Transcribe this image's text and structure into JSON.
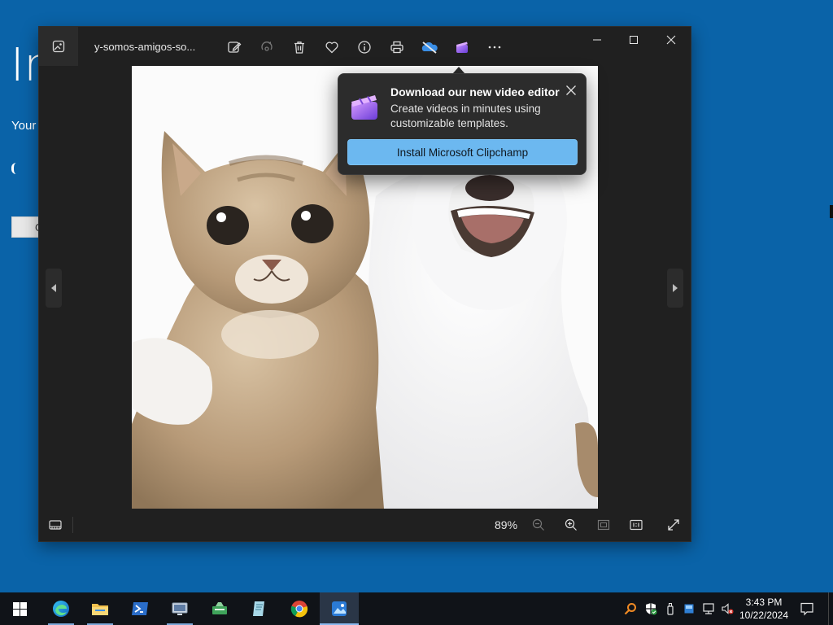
{
  "desktop": {
    "title_fragment": "In",
    "text_fragment": "Your",
    "button_fragment": "G"
  },
  "window": {
    "filename": "y-somos-amigos-so...",
    "zoom": "89%",
    "toolbar_icons": [
      "edit-image-icon",
      "rotate-icon",
      "delete-icon",
      "favorite-icon",
      "info-icon",
      "print-icon",
      "onedrive-icon",
      "clipchamp-icon",
      "more-icon"
    ]
  },
  "popup": {
    "title": "Download our new video editor",
    "body": "Create videos in minutes using customizable templates.",
    "install_label": "Install Microsoft Clipchamp"
  },
  "taskbar": {
    "apps": [
      "edge",
      "file-explorer",
      "powershell",
      "remote-desktop",
      "network-tool",
      "notepad",
      "chrome",
      "photos"
    ],
    "time": "3:43 PM",
    "date": "10/22/2024"
  },
  "colors": {
    "desktop": "#0a63a8",
    "window": "#202020",
    "accent": "#6cb8f0",
    "taskbar": "#101318"
  }
}
